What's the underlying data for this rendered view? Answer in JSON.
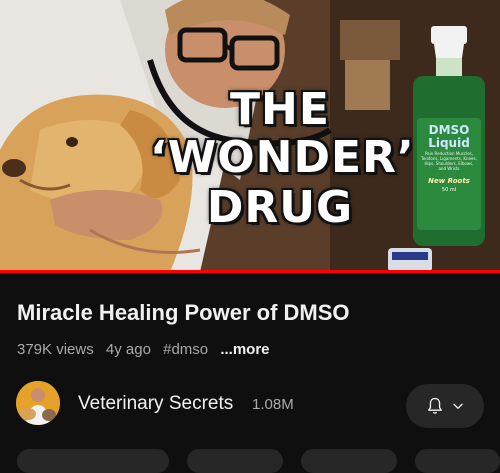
{
  "thumbnail": {
    "headline_line1": "THE",
    "headline_line2": "‘WONDER’",
    "headline_line3": "DRUG",
    "bottle": {
      "name": "DMSO",
      "product": "Liquid",
      "fine_print": "Pain Reduction Muscles, Tendons, Ligaments, Knees, Hips, Shoulders, Elbows, and Wrists",
      "brand": "New Roots",
      "size": "50 ml"
    },
    "progress_fraction": 1.0,
    "progress_color": "#ff0000"
  },
  "video": {
    "title": "Miracle Healing Power of DMSO",
    "views": "379K views",
    "age": "4y ago",
    "hashtag": "#dmso",
    "more_label": "...more"
  },
  "channel": {
    "name": "Veterinary Secrets",
    "subscribers": "1.08M",
    "avatar_icon": "channel-avatar",
    "bell_icon": "bell-icon",
    "chevron_icon": "chevron-down-icon"
  },
  "colors": {
    "background": "#0f0f0f",
    "text_primary": "#f1f1f1",
    "text_secondary": "#aaaaaa",
    "button_bg": "#272727",
    "avatar_bg": "#e6a12a"
  }
}
